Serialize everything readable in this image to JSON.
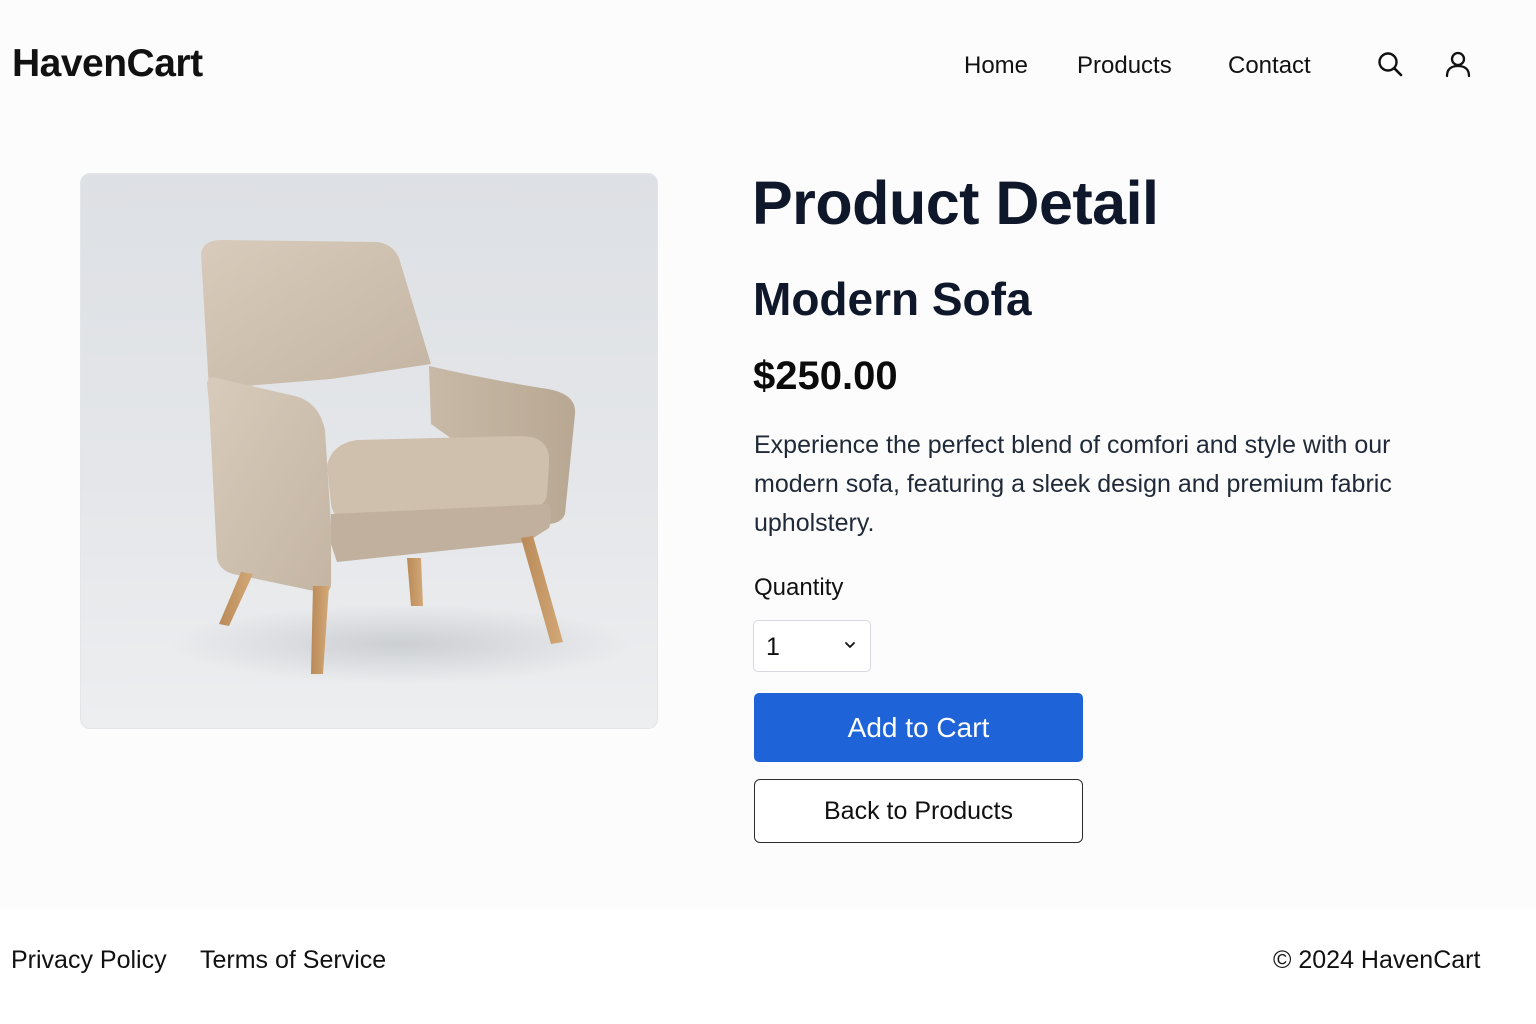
{
  "header": {
    "logo": "HavenCart",
    "nav": [
      {
        "label": "Home"
      },
      {
        "label": "Products"
      },
      {
        "label": "Contact"
      }
    ],
    "icons": [
      "search-icon",
      "user-icon"
    ]
  },
  "product": {
    "image_icon": "armchair-illustration",
    "page_title": "Product Detail",
    "name": "Modern Sofa",
    "price": "$250.00",
    "description": "Experience the perfect blend of comfori and style with our modern sofa, featuring a sleek design and premium fabric upholstery.",
    "quantity_label": "Quantity",
    "quantity_value": "1",
    "add_to_cart_label": "Add to Cart",
    "back_label": "Back to Products"
  },
  "footer": {
    "privacy": "Privacy Policy",
    "terms": "Terms of Service",
    "copyright": "© 2024 HavenCart"
  },
  "colors": {
    "accent": "#1f63d8",
    "background": "#fcfcfc",
    "text": "#111111"
  }
}
